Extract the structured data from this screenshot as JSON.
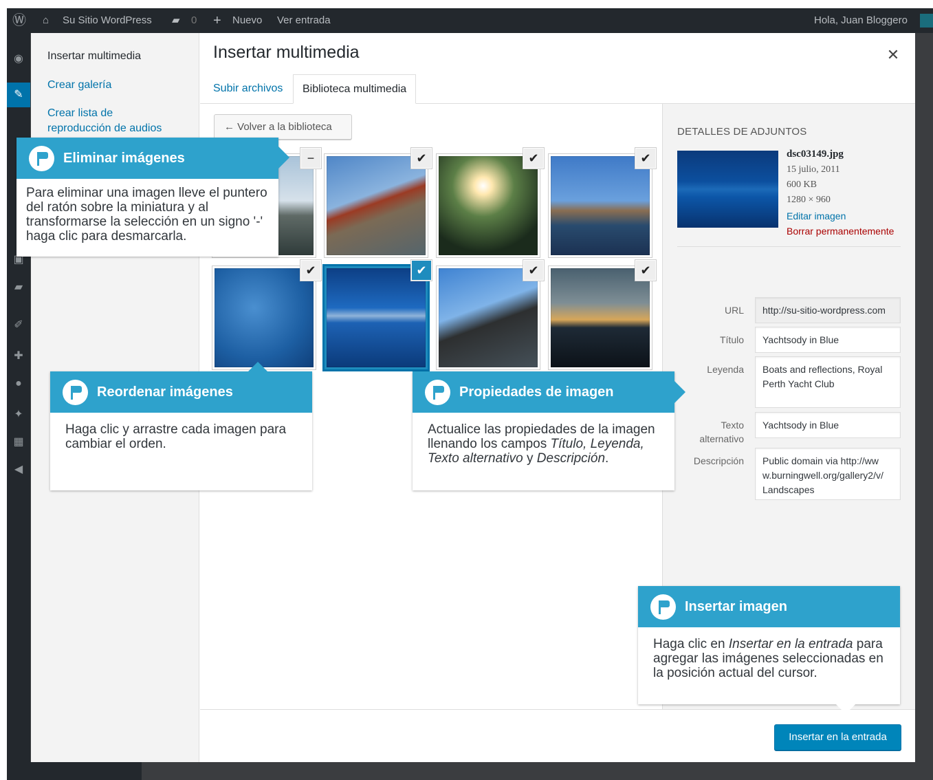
{
  "adminbar": {
    "site_name": "Su Sitio WordPress",
    "comments_count": "0",
    "new_label": "Nuevo",
    "view_post": "Ver entrada",
    "greeting": "Hola, Juan Bloggero"
  },
  "modal": {
    "title": "Insertar multimedia",
    "menu": [
      "Insertar multimedia",
      "Crear galería",
      "Crear lista de reproducción de audios"
    ],
    "tabs": [
      "Subir archivos",
      "Biblioteca multimedia"
    ],
    "back_button": "← Volver a la biblioteca",
    "insert_button": "Insertar en la entrada"
  },
  "thumbnails": [
    {
      "name": "pier-dock",
      "check": "−"
    },
    {
      "name": "golden-gate-bridge",
      "check": "✔"
    },
    {
      "name": "sun-through-trees",
      "check": "✔"
    },
    {
      "name": "wooden-pier",
      "check": "✔"
    },
    {
      "name": "rain-drops-water",
      "check": "✔"
    },
    {
      "name": "blue-marina",
      "check": "✔"
    },
    {
      "name": "harbour-bridge",
      "check": "✔"
    },
    {
      "name": "sunset-clouds",
      "check": "✔"
    }
  ],
  "attachment": {
    "heading": "Detalles de adjuntos",
    "filename": "dsc03149.jpg",
    "date": "15 julio, 2011",
    "size": "600 KB",
    "dimensions": "1280 × 960",
    "edit_link": "Editar imagen",
    "delete_link": "Borrar permanentemente",
    "fields": {
      "url_label": "URL",
      "url_value": "http://su-sitio-wordpress.com",
      "title_label": "Título",
      "title_value": "Yachtsody in Blue",
      "caption_label": "Leyenda",
      "caption_value": "Boats and reflections, Royal Perth Yacht Club",
      "alt_label": "Texto alternativo",
      "alt_value": "Yachtsody in Blue",
      "desc_label": "Descripción",
      "desc_value": "Public domain via http://www.burningwell.org/gallery2/v/Landscapes"
    }
  },
  "callouts": {
    "remove": {
      "title": "Eliminar imágenes",
      "body": "Para eliminar una imagen lleve el puntero del ratón sobre la miniatura y al transformarse la selección en un signo '-' haga clic para desmarcarla."
    },
    "reorder": {
      "title": "Reordenar imágenes",
      "body": "Haga clic y arrastre cada imagen para cambiar el orden."
    },
    "properties": {
      "title": "Propiedades de imagen",
      "body_1": "Actualice las propiedades de la imagen llenando los campos ",
      "body_em1": "Título, Leyenda, Texto alternativo",
      "body_2": " y ",
      "body_em2": "Descripción",
      "body_3": "."
    },
    "insert": {
      "title": "Insertar imagen",
      "body_1": "Haga clic en ",
      "body_em": "Insertar en la entrada",
      "body_2": " para agregar las imágenes seleccionadas en la posición actual del cursor."
    }
  },
  "colors": {
    "accent": "#2ea2cc",
    "link": "#0073aa",
    "delete": "#aa0000",
    "adminbar": "#23282d"
  }
}
